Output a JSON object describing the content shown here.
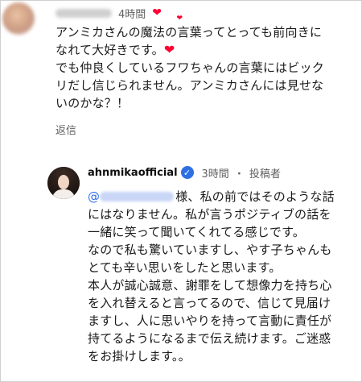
{
  "top_comment": {
    "time": "4時間",
    "text_lines": [
      "アンミカさんの魔法の言葉ってとっても前向きに",
      "なれて大好きです。"
    ],
    "text_lines_after_heart": [
      "でも仲良くしているフワちゃんの言葉にはビック",
      "リだし信じられません。アンミカさんには見せな",
      "いのかな？！"
    ],
    "reply_label": "返信"
  },
  "reply": {
    "channel_name": "ahnmikaofficial",
    "time": "3時間",
    "separator": "・",
    "author_badge": "投稿者",
    "mention_at": "@",
    "text_lines": [
      "様、私の前ではそのような話",
      "にはなりません。私が言うポジティブの話を",
      "一緒に笑って聞いてくれてる感じです。",
      "なので私も驚いていますし、やす子ちゃんも",
      "とても辛い思いをしたと思います。",
      "本人が誠心誠意、謝罪をして想像力を持ち心",
      "を入れ替えると言ってるので、信じて見届け",
      "ますし、人に思いやりを持って言動に責任が",
      "持てるようになるまで伝え続けます。ご迷惑",
      "をお掛けします。。"
    ]
  },
  "icons": {
    "heart": "heart-icon",
    "verified": "verified-check-icon"
  },
  "colors": {
    "heart": "#ff0033",
    "verified": "#2f6fe4",
    "meta": "#606060"
  }
}
